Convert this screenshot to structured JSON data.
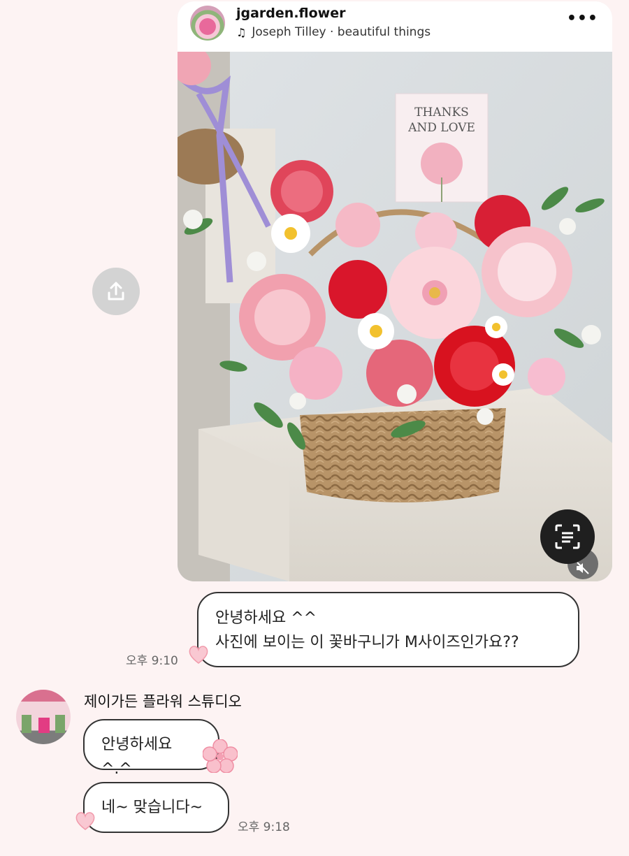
{
  "post": {
    "account_name": "jgarden.flower",
    "music": "Joseph Tilley · beautiful things",
    "card_text_line1": "THANKS",
    "card_text_line2": "AND LOVE"
  },
  "icons": {
    "more": "more-icon",
    "music": "music-note-icon",
    "share": "share-icon",
    "scan": "scan-text-icon",
    "mute": "speaker-muted-icon",
    "reaction": "heart-reaction-icon",
    "flower_reaction": "cherry-blossom-icon"
  },
  "messages": {
    "sent": {
      "line1": "안녕하세요 ^^",
      "line2": "사진에 보이는 이 꽃바구니가 M사이즈인가요??",
      "time": "오후 9:10"
    },
    "received": {
      "sender": "제이가든 플라워 스튜디오",
      "msg1": "안녕하세요^.^",
      "msg2": "네~ 맞습니다~",
      "time": "오후 9:18"
    }
  },
  "colors": {
    "background": "#fdf3f3",
    "bubble_border": "#333333",
    "accent_pink": "#f4a8b8"
  }
}
